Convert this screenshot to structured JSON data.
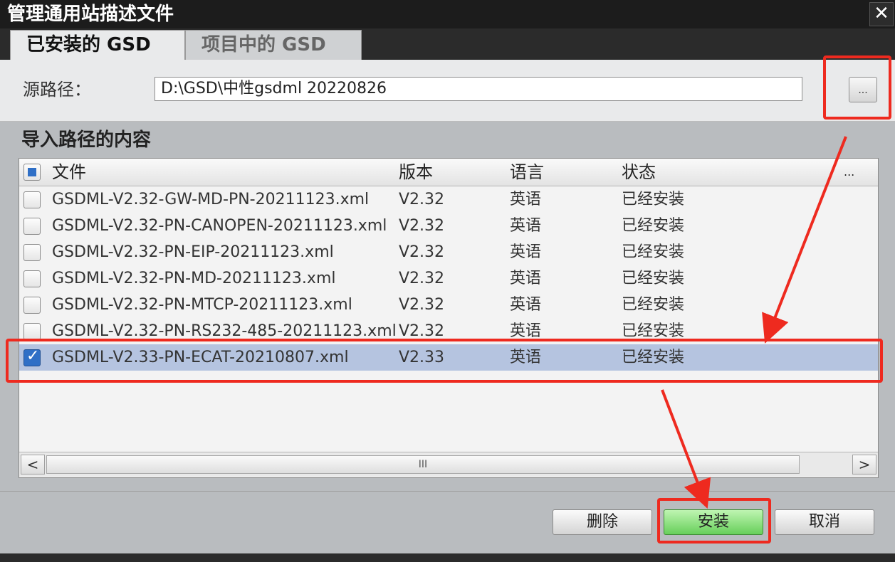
{
  "window": {
    "title": "管理通用站描述文件",
    "close_label": "✕"
  },
  "tabs": [
    {
      "label": "已安装的 GSD",
      "active": true
    },
    {
      "label": "项目中的 GSD",
      "active": false
    }
  ],
  "source": {
    "label": "源路径：",
    "value": "D:\\GSD\\中性gsdml 20220826",
    "browse_label": "..."
  },
  "section_title": "导入路径的内容",
  "table": {
    "columns": [
      "文件",
      "版本",
      "语言",
      "状态",
      "..."
    ],
    "rows": [
      {
        "file": "GSDML-V2.32-GW-MD-PN-20211123.xml",
        "version": "V2.32",
        "language": "英语",
        "status": "已经安装",
        "checked": false
      },
      {
        "file": "GSDML-V2.32-PN-CANOPEN-20211123.xml",
        "version": "V2.32",
        "language": "英语",
        "status": "已经安装",
        "checked": false
      },
      {
        "file": "GSDML-V2.32-PN-EIP-20211123.xml",
        "version": "V2.32",
        "language": "英语",
        "status": "已经安装",
        "checked": false
      },
      {
        "file": "GSDML-V2.32-PN-MD-20211123.xml",
        "version": "V2.32",
        "language": "英语",
        "status": "已经安装",
        "checked": false
      },
      {
        "file": "GSDML-V2.32-PN-MTCP-20211123.xml",
        "version": "V2.32",
        "language": "英语",
        "status": "已经安装",
        "checked": false
      },
      {
        "file": "GSDML-V2.32-PN-RS232-485-20211123.xml",
        "version": "V2.32",
        "language": "英语",
        "status": "已经安装",
        "checked": false
      },
      {
        "file": "GSDML-V2.33-PN-ECAT-20210807.xml",
        "version": "V2.33",
        "language": "英语",
        "status": "已经安装",
        "checked": true
      }
    ]
  },
  "scrollbar": {
    "left_arrow": "<",
    "right_arrow": ">",
    "thumb_grip": "III"
  },
  "buttons": {
    "delete": "删除",
    "install": "安装",
    "cancel": "取消"
  },
  "colors": {
    "selected_row": "#b5c4e0",
    "install_button": "#67cf5a",
    "annotation": "#ee2a1f",
    "checkbox_blue": "#2f6fc6"
  }
}
